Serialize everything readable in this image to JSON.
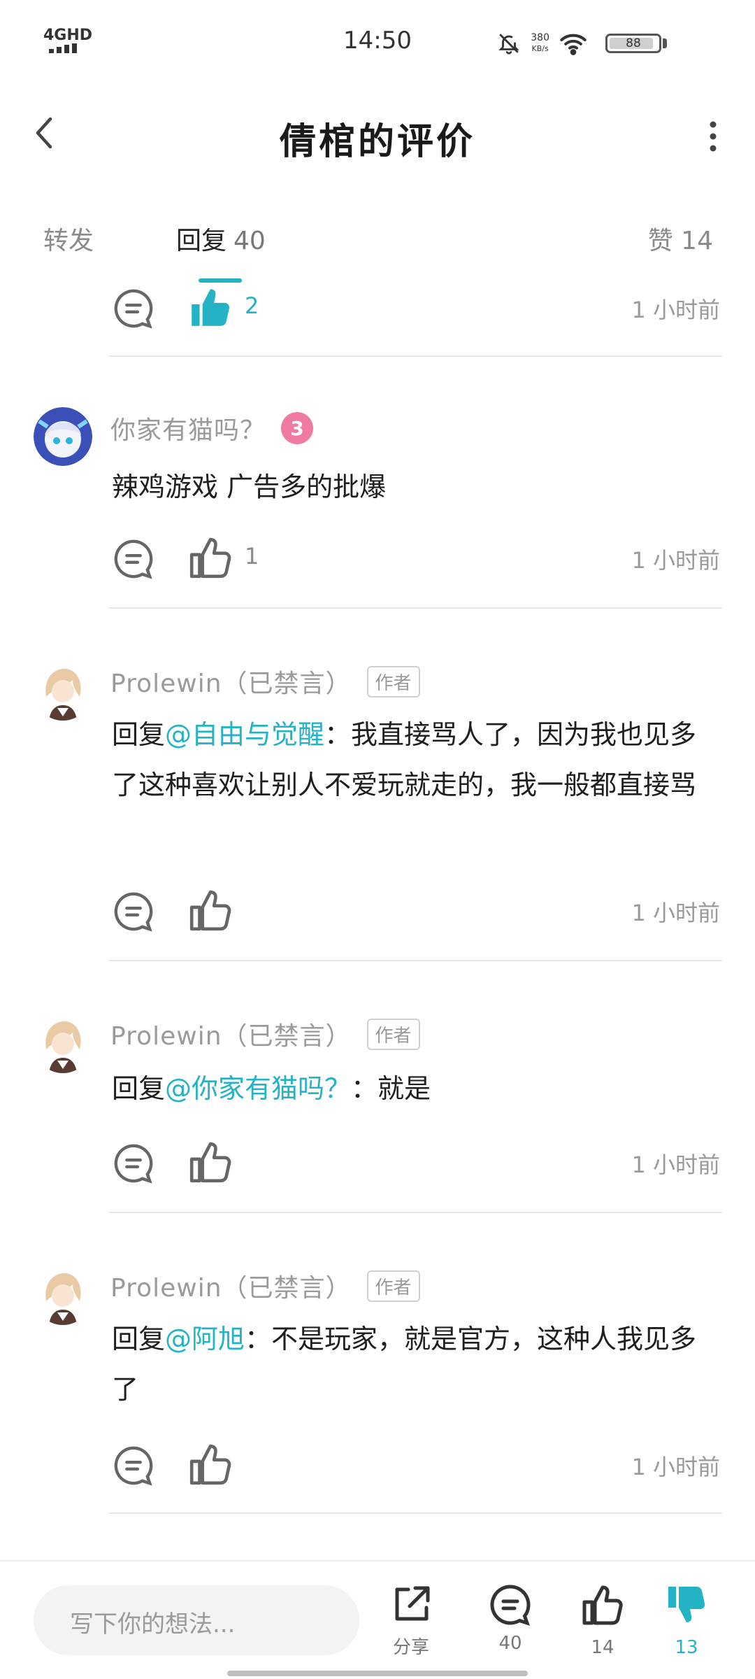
{
  "status_bar": {
    "network": "4GHD",
    "time": "14:50",
    "speed_value": "380",
    "speed_unit": "KB/s",
    "battery": "88"
  },
  "header": {
    "title": "倩棺的评价"
  },
  "tabs": {
    "repost": "转发",
    "reply": "回复",
    "reply_count": "40",
    "likes": "赞 14"
  },
  "top_actions": {
    "like_count": "2",
    "time": "1 小时前"
  },
  "comments": [
    {
      "user": "你家有猫吗？",
      "level": "3",
      "text": "辣鸡游戏 广告多的批爆",
      "like_count": "1",
      "time": "1 小时前"
    },
    {
      "user": "Prolewin（已禁言）",
      "tag": "作者",
      "prefix": "回复",
      "mention": "@自由与觉醒",
      "text": "：我直接骂人了，因为我也见多了这种喜欢让别人不爱玩就走的，我一般都直接骂",
      "time": "1 小时前"
    },
    {
      "user": "Prolewin（已禁言）",
      "tag": "作者",
      "prefix": "回复",
      "mention": "@你家有猫吗？",
      "text": "：就是",
      "time": "1 小时前"
    },
    {
      "user": "Prolewin（已禁言）",
      "tag": "作者",
      "prefix": "回复",
      "mention": "@阿旭",
      "text": "：不是玩家，就是官方，这种人我见多了",
      "time": "1 小时前"
    }
  ],
  "bottom_bar": {
    "input_placeholder": "写下你的想法...",
    "share_label": "分享",
    "comment_count": "40",
    "like_count": "14",
    "dislike_count": "13"
  },
  "colors": {
    "accent": "#24b3c5",
    "muted": "#9a9a9a"
  }
}
